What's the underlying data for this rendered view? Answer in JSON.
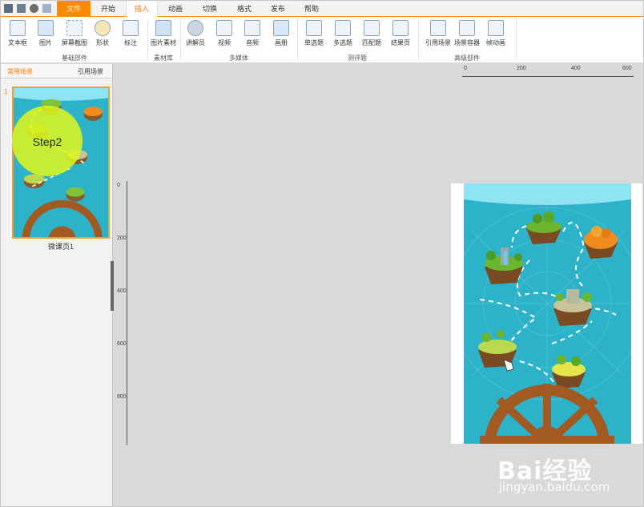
{
  "menu_tabs": [
    "文件",
    "开始",
    "插入",
    "动画",
    "切换",
    "格式",
    "发布",
    "帮助"
  ],
  "active_tab": "插入",
  "ribbon": {
    "basic": {
      "items": [
        "文本框",
        "图片",
        "屏幕截图",
        "形状",
        "标注"
      ],
      "group": "基础部件"
    },
    "material": {
      "items": [
        "图片素材"
      ],
      "group": "素材库"
    },
    "media": {
      "items": [
        "讲解员",
        "视频",
        "音频",
        "画册"
      ],
      "group": "多媒体"
    },
    "quiz": {
      "items": [
        "单选题",
        "多选题",
        "匹配题",
        "结果页"
      ],
      "group": "测评题"
    },
    "advanced": {
      "items": [
        "引用场景",
        "场景容器",
        "帧动画"
      ],
      "group": "高级部件"
    }
  },
  "left_panel": {
    "tab_left": "常用场景",
    "tab_right": "引用场景",
    "slide_number": "1",
    "slide_label": "微课页1"
  },
  "rulers": {
    "h_ticks": [
      "0",
      "200",
      "400",
      "600"
    ],
    "v_ticks": [
      "0",
      "200",
      "400",
      "600",
      "800"
    ]
  },
  "overlay": {
    "step": "Step2"
  },
  "watermark": {
    "logo": "Bai经验",
    "url": "jingyan.baidu.com"
  },
  "colors": {
    "accent": "#ff8a00",
    "ocean": "#2db3c9",
    "highlight": "#dcf51e"
  }
}
